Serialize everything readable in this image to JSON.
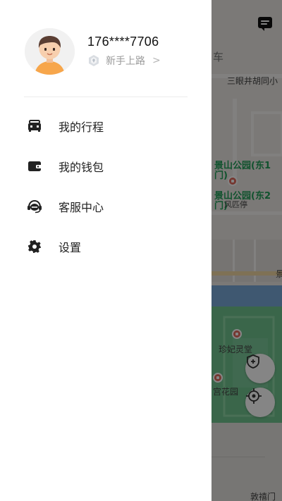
{
  "profile": {
    "phone": "176****7706",
    "level_label": "新手上路",
    "level_chevron": ">"
  },
  "menu": [
    {
      "label": "我的行程",
      "icon": "car-icon"
    },
    {
      "label": "我的钱包",
      "icon": "wallet-icon"
    },
    {
      "label": "客服中心",
      "icon": "headset-icon"
    },
    {
      "label": "设置",
      "icon": "gear-icon"
    }
  ],
  "map": {
    "labels": {
      "car_tab": "车",
      "street": "三眼井胡同小",
      "park_east1_line1": "景山公园(东1",
      "park_east1_line2": "门)",
      "park_east2_line1": "景山公园(东2",
      "park_east2_line2": "门)",
      "feng_ting": "风匹停",
      "concubine_well": "珍妃灵堂",
      "palace_garden": "宫花园",
      "edge_char": "景",
      "gate": "敦禧门"
    }
  },
  "colors": {
    "map_base": "#e9e7e3",
    "park_green": "#6fc48f",
    "moat_blue": "#7aa9d8",
    "drawer_bg": "#ffffff",
    "avatar_skin": "#f7cfae",
    "avatar_shirt": "#f7a64b",
    "icon_dark": "#222222"
  }
}
